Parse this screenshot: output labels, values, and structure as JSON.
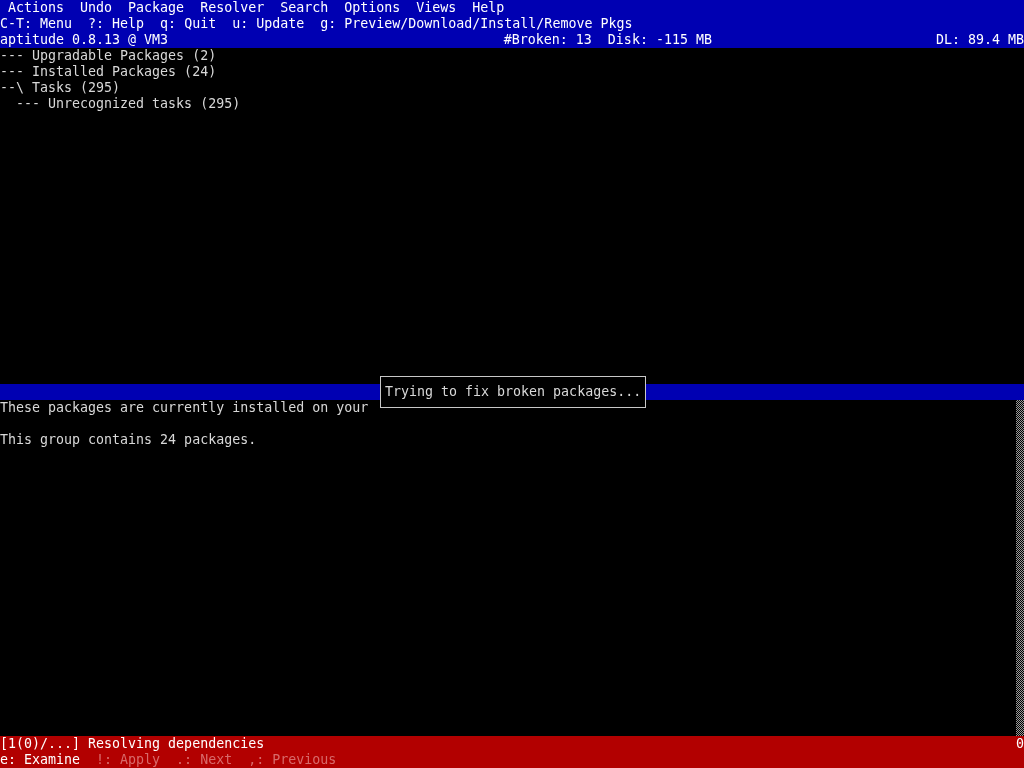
{
  "menu_bar": {
    "items": [
      "Actions",
      "Undo",
      "Package",
      "Resolver",
      "Search",
      "Options",
      "Views",
      "Help"
    ]
  },
  "key_hints": [
    "C-T: Menu",
    "?: Help",
    "q: Quit",
    "u: Update",
    "g: Preview/Download/Install/Remove Pkgs"
  ],
  "header": {
    "title": "aptitude 0.8.13 @ VM3",
    "broken": "#Broken: 13",
    "disk": "Disk: -115 MB",
    "download": "DL: 89.4 MB"
  },
  "tree": [
    {
      "prefix": "---",
      "label": "Upgradable Packages (2)"
    },
    {
      "prefix": "---",
      "label": "Installed Packages (24)"
    },
    {
      "prefix": "--\\",
      "label": "Tasks (295)",
      "children": [
        {
          "prefix": "---",
          "label": "Unrecognized tasks (295)"
        }
      ]
    }
  ],
  "description": [
    "These packages are currently installed on your",
    "This group contains 24 packages."
  ],
  "popup": {
    "message": "Trying to fix broken packages..."
  },
  "resolver_bar": {
    "progress": "[1(0)/...] Resolving dependencies",
    "count": "0",
    "actions": [
      {
        "label": "e: Examine",
        "disabled": false
      },
      {
        "label": "!: Apply",
        "disabled": true
      },
      {
        "label": ".: Next",
        "disabled": true
      },
      {
        "label": ",: Previous",
        "disabled": true
      }
    ]
  }
}
